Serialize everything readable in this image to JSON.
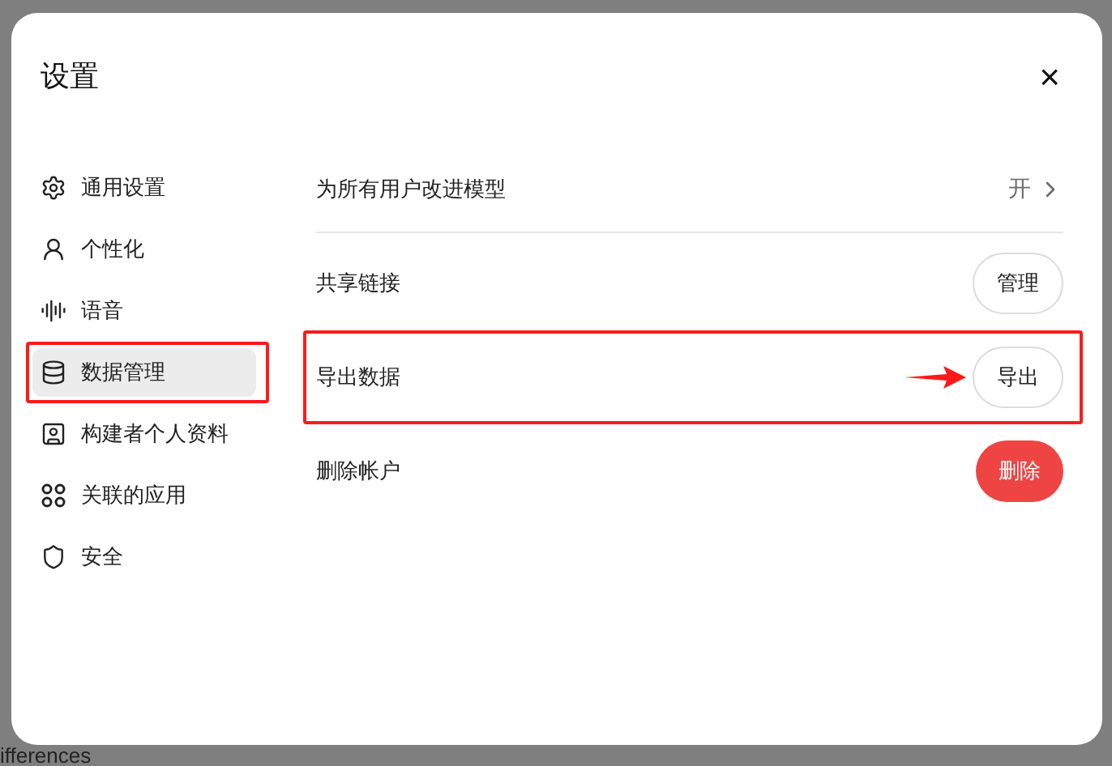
{
  "dialog": {
    "title": "设置",
    "close": "×"
  },
  "sidebar": {
    "items": [
      {
        "kind": "gear",
        "label": "通用设置",
        "selected": false,
        "highlighted": false
      },
      {
        "kind": "person",
        "label": "个性化",
        "selected": false,
        "highlighted": false
      },
      {
        "kind": "audio",
        "label": "语音",
        "selected": false,
        "highlighted": false
      },
      {
        "kind": "database",
        "label": "数据管理",
        "selected": true,
        "highlighted": true
      },
      {
        "kind": "badge",
        "label": "构建者个人资料",
        "selected": false,
        "highlighted": false
      },
      {
        "kind": "apps",
        "label": "关联的应用",
        "selected": false,
        "highlighted": false
      },
      {
        "kind": "shield",
        "label": "安全",
        "selected": false,
        "highlighted": false
      }
    ]
  },
  "rows": [
    {
      "label": "为所有用户改进模型",
      "kind": "link",
      "value": "开",
      "highlighted": false,
      "pointer": false
    },
    {
      "label": "共享链接",
      "kind": "button",
      "value": "管理",
      "highlighted": false,
      "pointer": false
    },
    {
      "label": "导出数据",
      "kind": "button",
      "value": "导出",
      "highlighted": true,
      "pointer": true
    },
    {
      "label": "删除帐户",
      "kind": "danger",
      "value": "删除",
      "highlighted": false,
      "pointer": false
    }
  ],
  "background_text": "ifferences"
}
